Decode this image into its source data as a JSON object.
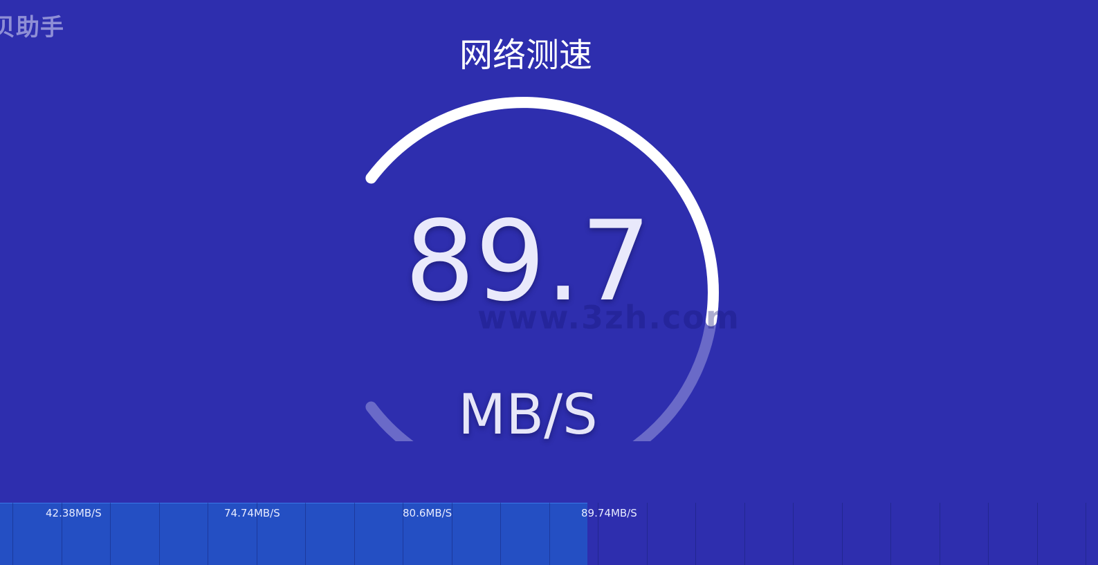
{
  "app": {
    "logo_text": "贝助手",
    "title": "网络测速",
    "watermark": "www.3zh.com"
  },
  "gauge": {
    "value": "89.7",
    "unit": "MB/S",
    "progress_fraction": 0.53,
    "colors": {
      "background": "#2e2eae",
      "arc_progress": "#ffffff",
      "arc_track": "#6a6ac8"
    }
  },
  "history": {
    "filled_fraction": 0.535,
    "readings": [
      {
        "label": "42.38MB/S"
      },
      {
        "label": "74.74MB/S"
      },
      {
        "label": "80.6MB/S"
      },
      {
        "label": "89.74MB/S"
      }
    ],
    "colors": {
      "filled": "#244fc3",
      "empty": "#2e2eae"
    }
  }
}
